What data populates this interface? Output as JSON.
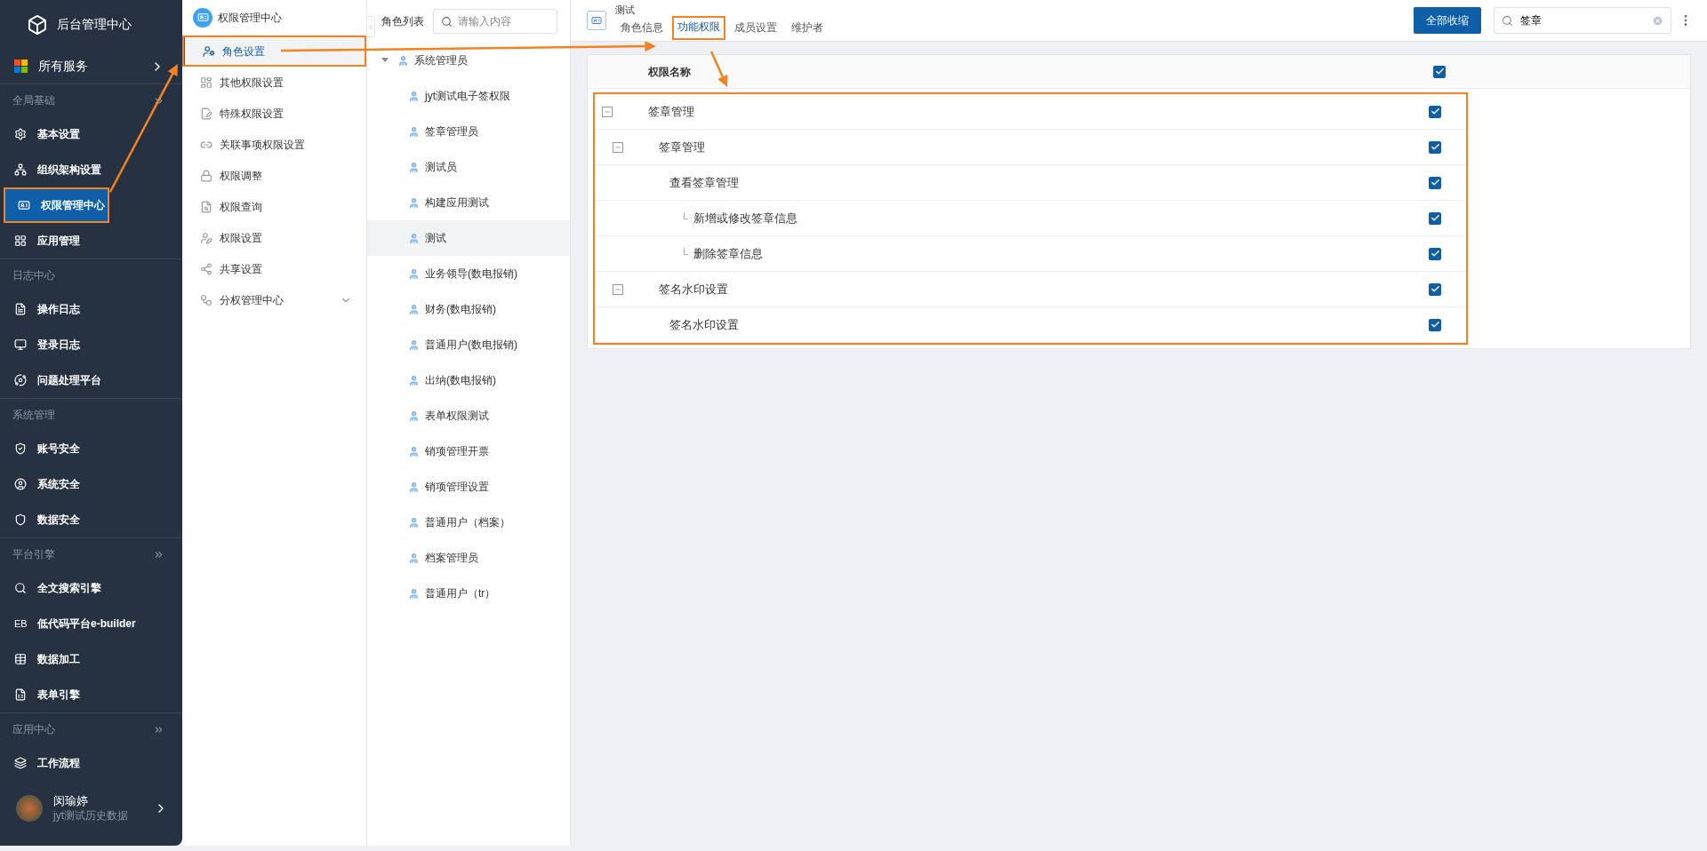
{
  "app": {
    "title": "后台管理中心",
    "all_services": "所有服务"
  },
  "sidebar": {
    "sections": [
      {
        "title": "全局基础",
        "items": [
          {
            "label": "基本设置",
            "selected": false,
            "highlighted": false
          },
          {
            "label": "组织架构设置",
            "selected": false,
            "highlighted": false
          },
          {
            "label": "权限管理中心",
            "selected": true,
            "highlighted": true
          },
          {
            "label": "应用管理",
            "selected": false,
            "highlighted": false
          }
        ],
        "collapsible": true
      },
      {
        "title": "日志中心",
        "items": [
          {
            "label": "操作日志",
            "selected": false,
            "highlighted": false
          },
          {
            "label": "登录日志",
            "selected": false,
            "highlighted": false
          },
          {
            "label": "问题处理平台",
            "selected": false,
            "highlighted": false
          }
        ],
        "collapsible": false
      },
      {
        "title": "系统管理",
        "items": [
          {
            "label": "账号安全",
            "selected": false,
            "highlighted": false
          },
          {
            "label": "系统安全",
            "selected": false,
            "highlighted": false
          },
          {
            "label": "数据安全",
            "selected": false,
            "highlighted": false
          }
        ],
        "collapsible": false
      },
      {
        "title": "平台引擎",
        "items": [
          {
            "label": "全文搜索引擎",
            "selected": false,
            "highlighted": false
          },
          {
            "label": "低代码平台e-builder",
            "icon_text": "EB",
            "selected": false,
            "highlighted": false
          },
          {
            "label": "数据加工",
            "selected": false,
            "highlighted": false
          },
          {
            "label": "表单引擎",
            "selected": false,
            "highlighted": false
          }
        ],
        "collapsible": true
      },
      {
        "title": "应用中心",
        "items": [
          {
            "label": "工作流程",
            "selected": false,
            "highlighted": false
          }
        ],
        "collapsible": true
      }
    ],
    "user": {
      "name": "闵瑜婷",
      "subtitle": "jyt测试历史数据"
    }
  },
  "submenu": {
    "title": "权限管理中心",
    "items": [
      {
        "label": "角色设置",
        "selected": true,
        "highlighted": true
      },
      {
        "label": "其他权限设置",
        "selected": false,
        "highlighted": false
      },
      {
        "label": "特殊权限设置",
        "selected": false,
        "highlighted": false
      },
      {
        "label": "关联事项权限设置",
        "selected": false,
        "highlighted": false
      },
      {
        "label": "权限调整",
        "selected": false,
        "highlighted": false
      },
      {
        "label": "权限查询",
        "selected": false,
        "highlighted": false
      },
      {
        "label": "权限设置",
        "selected": false,
        "highlighted": false
      },
      {
        "label": "共享设置",
        "selected": false,
        "highlighted": false
      },
      {
        "label": "分权管理中心",
        "selected": false,
        "highlighted": false,
        "expandable": true
      }
    ]
  },
  "roles": {
    "title": "角色列表",
    "search_placeholder": "请输入内容",
    "tree": {
      "label": "系统管理员",
      "expanded": true,
      "children": [
        {
          "label": "jyt测试电子签权限",
          "selected": false
        },
        {
          "label": "签章管理员",
          "selected": false
        },
        {
          "label": "测试员",
          "selected": false
        },
        {
          "label": "构建应用测试",
          "selected": false
        },
        {
          "label": "测试",
          "selected": true
        },
        {
          "label": "业务领导(数电报销)",
          "selected": false
        },
        {
          "label": "财务(数电报销)",
          "selected": false
        },
        {
          "label": "普通用户(数电报销)",
          "selected": false
        },
        {
          "label": "出纳(数电报销)",
          "selected": false
        },
        {
          "label": "表单权限测试",
          "selected": false
        },
        {
          "label": "销项管理开票",
          "selected": false
        },
        {
          "label": "销项管理设置",
          "selected": false
        },
        {
          "label": "普通用户（档案）",
          "selected": false
        },
        {
          "label": "档案管理员",
          "selected": false
        },
        {
          "label": "普通用户（tr）",
          "selected": false
        }
      ]
    }
  },
  "detail": {
    "role": "测试",
    "tabs": [
      {
        "label": "角色信息",
        "selected": false,
        "highlighted": false
      },
      {
        "label": "功能权限",
        "selected": true,
        "highlighted": true
      },
      {
        "label": "成员设置",
        "selected": false,
        "highlighted": false
      },
      {
        "label": "维护者",
        "selected": false,
        "highlighted": false
      }
    ],
    "collapse_button": "全部收缩",
    "search_value": "签章",
    "table": {
      "header": "权限名称",
      "header_checked": true,
      "highlighted": true,
      "rows": [
        {
          "label": "签章管理",
          "checked": true,
          "expanded": true,
          "children": [
            {
              "label": "签章管理",
              "checked": true,
              "expanded": true,
              "children": [
                {
                  "label": "查看签章管理",
                  "checked": true,
                  "children": [
                    {
                      "label": "新增或修改签章信息",
                      "branch_mark": "└",
                      "checked": true
                    },
                    {
                      "label": "删除签章信息",
                      "branch_mark": "└",
                      "checked": true
                    }
                  ]
                }
              ]
            },
            {
              "label": "签名水印设置",
              "checked": true,
              "expanded": true,
              "children": [
                {
                  "label": "签名水印设置",
                  "checked": true
                }
              ]
            }
          ]
        }
      ]
    }
  },
  "annotations": {
    "arrows": [
      {
        "kind": "up"
      },
      {
        "kind": "right"
      },
      {
        "kind": "down"
      }
    ]
  }
}
